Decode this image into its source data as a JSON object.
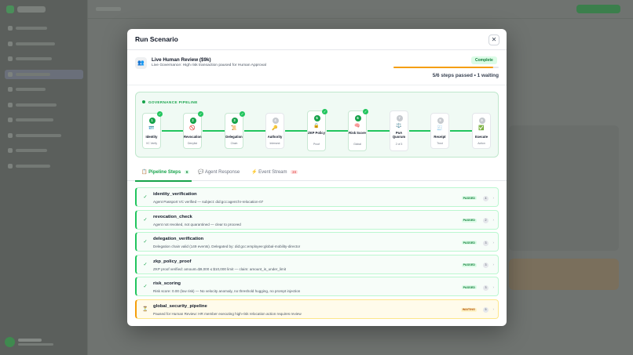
{
  "modal": {
    "title": "Run Scenario",
    "close_glyph": "✕"
  },
  "scenario": {
    "icon": "👥",
    "title": "Live Human Review ($9k)",
    "subtitle": "Live Governance: High risk transaction paused for Human Approval",
    "status": "Complete",
    "progress": 0.95,
    "summary": "5/6 steps passed • 1 waiting"
  },
  "pipeline": {
    "label": "GOVERNANCE PIPELINE",
    "stages": [
      {
        "num": "1",
        "emoji": "🪪",
        "name": "Identity",
        "sub": "VC Verify",
        "done": true
      },
      {
        "num": "2",
        "emoji": "🚫",
        "name": "Revocation",
        "sub": "Denylist",
        "done": true
      },
      {
        "num": "3",
        "emoji": "📜",
        "name": "Delegation",
        "sub": "Chain",
        "done": true
      },
      {
        "num": "4",
        "emoji": "🔑",
        "name": "Authority",
        "sub": "Intersect",
        "done": false
      },
      {
        "num": "5",
        "emoji": "🔒",
        "name": "ZKP Policy",
        "sub": "Proof",
        "done": true
      },
      {
        "num": "6",
        "emoji": "🧠",
        "name": "Risk Score",
        "sub": "Global",
        "done": true
      },
      {
        "num": "7",
        "emoji": "⚖️",
        "name": "PoA Quorum",
        "sub": "2 of 3",
        "done": false
      },
      {
        "num": "8",
        "emoji": "🧾",
        "name": "Receipt",
        "sub": "Trust",
        "done": false
      },
      {
        "num": "9",
        "emoji": "✅",
        "name": "Execute",
        "sub": "Action",
        "done": false
      }
    ]
  },
  "tabs": [
    {
      "icon": "📋",
      "label": "Pipeline Steps",
      "count": "6"
    },
    {
      "icon": "💬",
      "label": "Agent Response",
      "count": ""
    },
    {
      "icon": "⚡",
      "label": "Event Stream",
      "count": "24"
    }
  ],
  "steps": [
    {
      "icon": "✓",
      "name": "identity_verification",
      "desc": "Agent Passport VC verified — subject: did:gcc:agent:hr-relocation-07",
      "status": "PASSED",
      "count": "4"
    },
    {
      "icon": "✓",
      "name": "revocation_check",
      "desc": "Agent not revoked, not quarantined — clear to proceed",
      "status": "PASSED",
      "count": "2"
    },
    {
      "icon": "✓",
      "name": "delegation_verification",
      "desc": "Delegation chain valid (149 events). Delegated by: did:gcc:employee:global-mobility-director",
      "status": "PASSED",
      "count": "3"
    },
    {
      "icon": "✓",
      "name": "zkp_policy_proof",
      "desc": "ZKP proof verified: amount=$9,000 ≤ $10,000 limit — claim: amount_is_under_limit",
      "status": "PASSED",
      "count": "3"
    },
    {
      "icon": "✓",
      "name": "risk_scoring",
      "desc": "Risk score: 0.00 (low risk) — No velocity anomaly, no threshold hugging, no prompt injection",
      "status": "PASSED",
      "count": "3"
    },
    {
      "icon": "⏳",
      "name": "global_security_pipeline",
      "desc": "Paused for Human Review: HR member executing high-risk relocation action requires review",
      "status": "WAITING",
      "count": "5"
    }
  ],
  "colors": {
    "accent": "#16a34a",
    "progress": "#f59e0b",
    "waiting": "#b45309"
  }
}
